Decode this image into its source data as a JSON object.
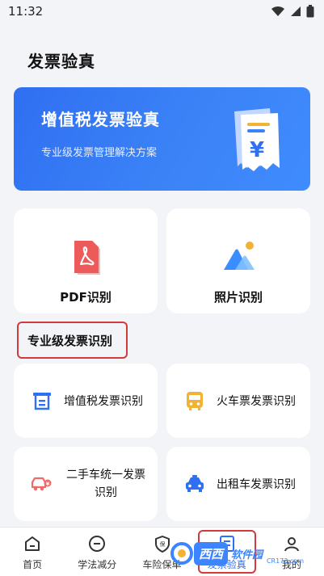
{
  "status_bar": {
    "time": "11:32"
  },
  "page_title": "发票验真",
  "banner": {
    "title": "增值税发票验真",
    "subtitle": "专业级发票管理解决方案"
  },
  "big_cards": [
    {
      "label": "PDF识别",
      "icon": "pdf-icon"
    },
    {
      "label": "照片识别",
      "icon": "photo-icon"
    }
  ],
  "section_title": "专业级发票识别",
  "small_cards": [
    {
      "label": "增值税发票识别",
      "icon": "vat-invoice-icon"
    },
    {
      "label": "火车票发票识别",
      "icon": "train-ticket-icon"
    },
    {
      "label": "二手车统一发票识别",
      "icon": "used-car-invoice-icon"
    },
    {
      "label": "出租车发票识别",
      "icon": "taxi-icon"
    }
  ],
  "bottom_nav": [
    {
      "label": "首页",
      "icon": "home-icon"
    },
    {
      "label": "学法减分",
      "icon": "minus-circle-icon"
    },
    {
      "label": "车险保单",
      "icon": "insurance-icon"
    },
    {
      "label": "发票验真",
      "icon": "invoice-scan-icon"
    },
    {
      "label": "我的",
      "icon": "user-icon"
    }
  ],
  "watermark": {
    "badge": "西西",
    "text": "软件园",
    "url": "CR173.com"
  },
  "colors": {
    "accent": "#2f6ff2",
    "highlight": "#d13b3b"
  }
}
